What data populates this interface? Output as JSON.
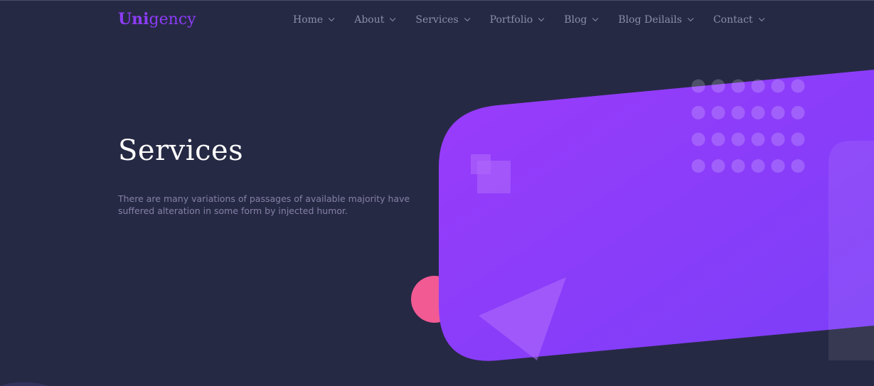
{
  "brand": {
    "logo_bold": "Uni",
    "logo_light": "gency",
    "color": "#8c3cf6"
  },
  "nav": {
    "items": [
      {
        "label": "Home"
      },
      {
        "label": "About"
      },
      {
        "label": "Services"
      },
      {
        "label": "Portfolio"
      },
      {
        "label": "Blog"
      },
      {
        "label": "Blog Deilails"
      },
      {
        "label": "Contact"
      }
    ]
  },
  "hero": {
    "title": "Services",
    "description": "There are many variations of passages of available majority have suffered alteration in some form by injected humor."
  },
  "colors": {
    "background": "#262944",
    "accent_purple": "#8c3cf6",
    "accent_pink": "#f25a94",
    "nav_text": "#8b8ea8"
  },
  "icons": {
    "nav_chevron": "chevron-down-icon"
  }
}
